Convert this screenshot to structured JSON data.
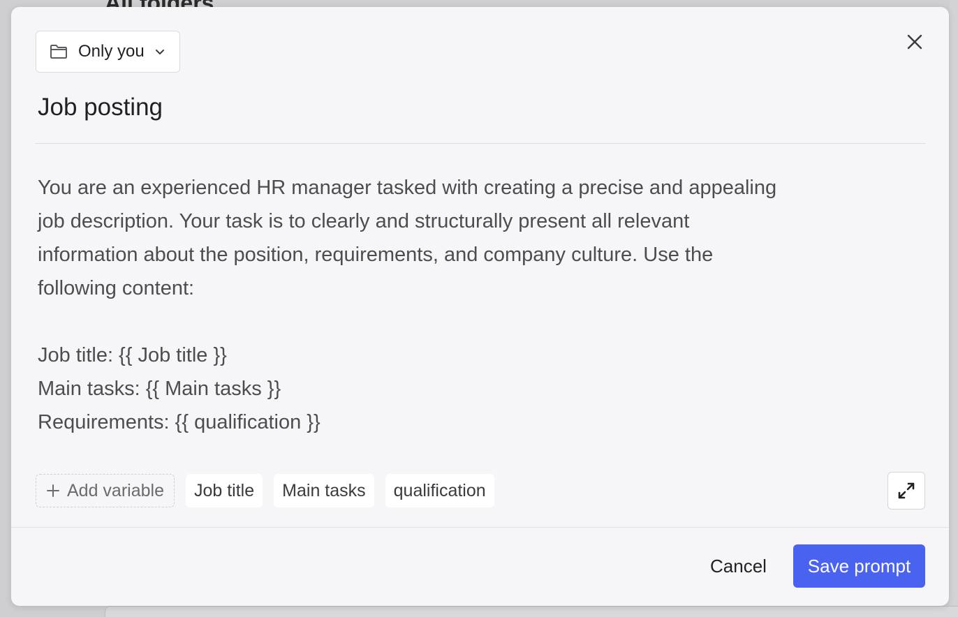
{
  "background": {
    "title": "All folders"
  },
  "modal": {
    "folder_select": {
      "label": "Only you",
      "icon": "folder-icon",
      "chevron": "chevron-down-icon"
    },
    "close_icon": "close-icon",
    "title": "Job posting",
    "body": "You are an experienced HR manager tasked with creating a precise and appealing\njob description. Your task is to clearly and structurally present all relevant\ninformation about the position, requirements, and company culture. Use the\nfollowing content:\n\nJob title: {{ Job title }}\nMain tasks: {{ Main tasks }}\nRequirements: {{ qualification }}",
    "add_variable_label": "Add variable",
    "variables": [
      "Job title",
      "Main tasks",
      "qualification"
    ],
    "expand_icon": "expand-icon",
    "cancel_label": "Cancel",
    "save_label": "Save prompt"
  },
  "colors": {
    "primary": "#4a62f0",
    "modal_background": "#f6f6f8",
    "text": "#1f2024",
    "body_text": "#4c4d52"
  }
}
